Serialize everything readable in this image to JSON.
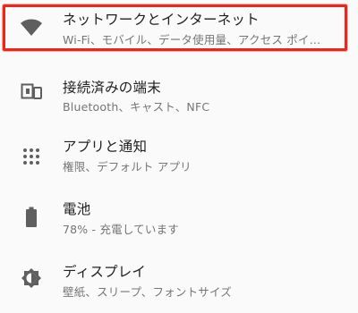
{
  "settings": {
    "items": [
      {
        "id": "network",
        "icon": "wifi-icon",
        "title": "ネットワークとインターネット",
        "subtitle": "Wi-Fi、モバイル、データ使用量、アクセス ポイ…"
      },
      {
        "id": "connected-devices",
        "icon": "devices-icon",
        "title": "接続済みの端末",
        "subtitle": "Bluetooth、キャスト、NFC"
      },
      {
        "id": "apps",
        "icon": "apps-grid-icon",
        "title": "アプリと通知",
        "subtitle": "権限、デフォルト アプリ"
      },
      {
        "id": "battery",
        "icon": "battery-icon",
        "title": "電池",
        "subtitle": "78% - 充電しています"
      },
      {
        "id": "display",
        "icon": "brightness-icon",
        "title": "ディスプレイ",
        "subtitle": "壁紙、スリープ、フォントサイズ"
      }
    ],
    "highlight_color": "#e8281c"
  }
}
